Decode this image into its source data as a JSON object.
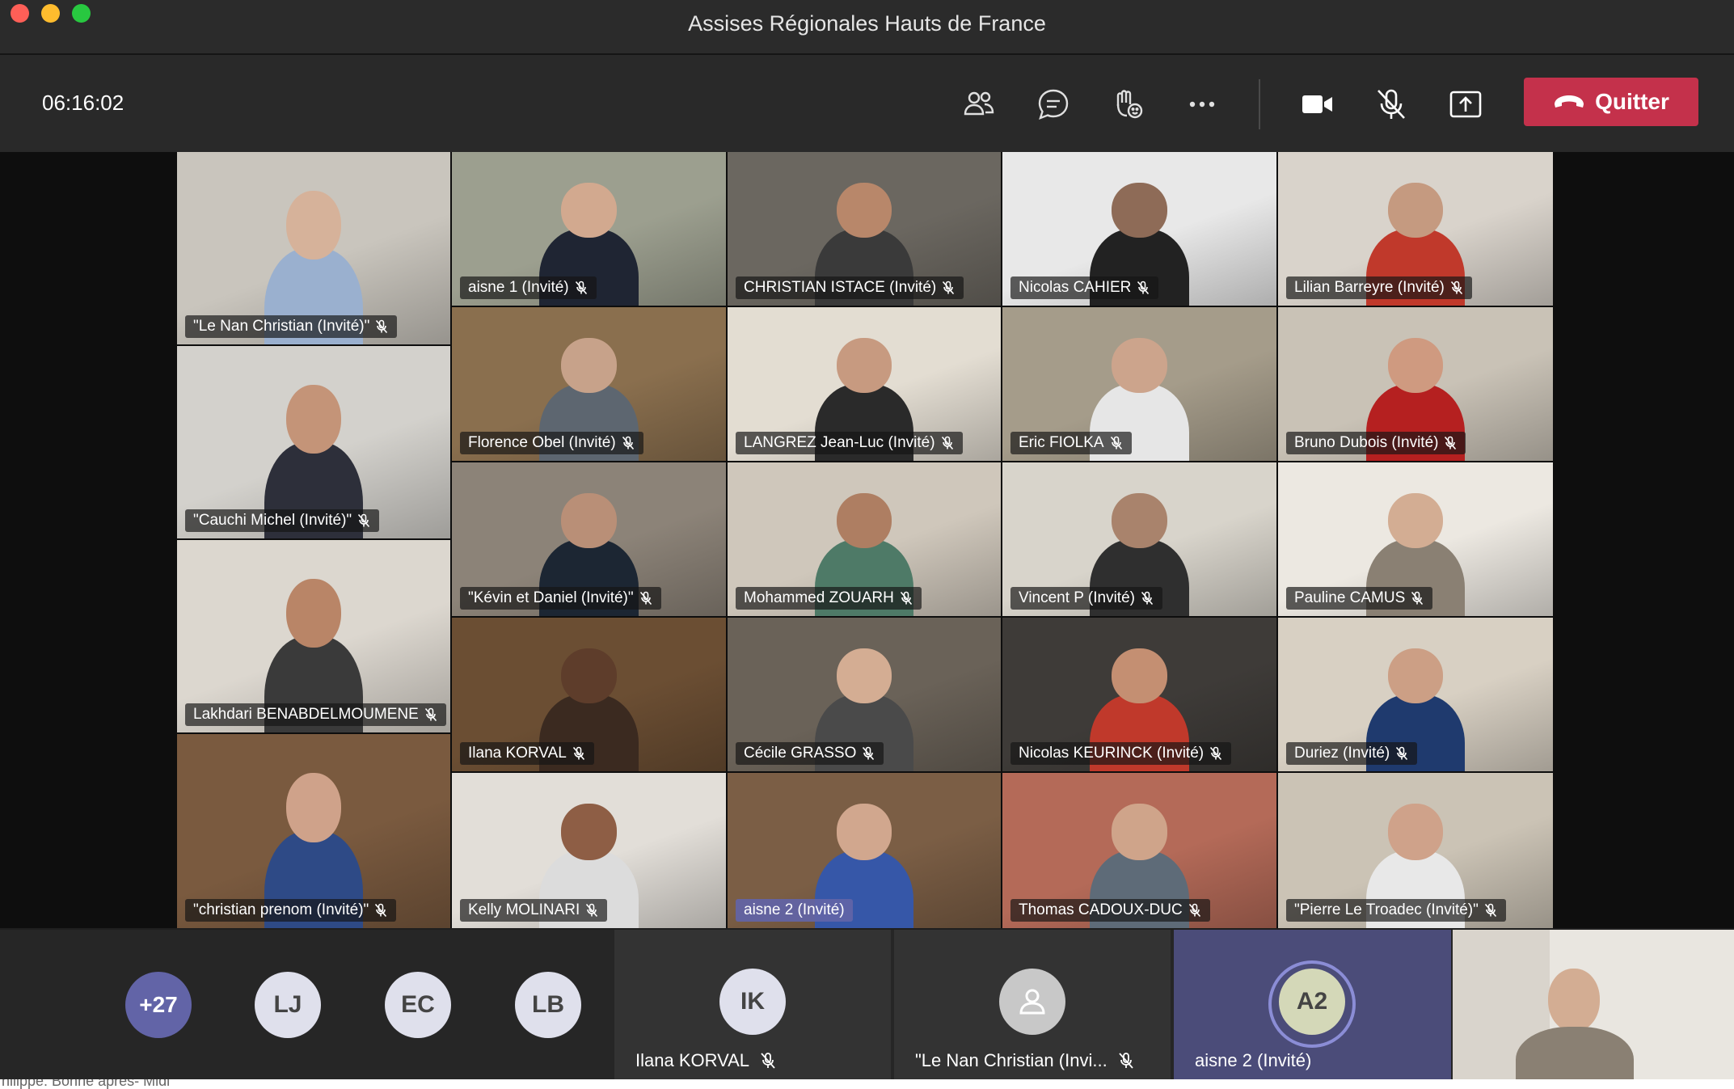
{
  "window": {
    "title": "Assises Régionales Hauts de France"
  },
  "toolbar": {
    "timer": "06:16:02",
    "leave_label": "Quitter",
    "icons": [
      "participants-icon",
      "chat-icon",
      "reactions-icon",
      "more-icon",
      "camera-icon",
      "mic-off-icon",
      "share-icon"
    ]
  },
  "participants": [
    {
      "name": "\"Le Nan Christian (Invité)\"",
      "room": "#c9c5bd",
      "skin": "#d6b29a",
      "shirt": "#9ab0cf"
    },
    {
      "name": "aisne 1 (Invité)",
      "room": "#9c9f8f",
      "skin": "#d2a98f",
      "shirt": "#1f2533"
    },
    {
      "name": "CHRISTIAN ISTACE (Invité)",
      "room": "#6b6760",
      "skin": "#b8876a",
      "shirt": "#3a3a3a"
    },
    {
      "name": "Nicolas CAHIER",
      "room": "#e8e8e8",
      "skin": "#8e6b57",
      "shirt": "#222222"
    },
    {
      "name": "Lilian Barreyre (Invité)",
      "room": "#d9d3cb",
      "skin": "#c59a80",
      "shirt": "#c0392b"
    },
    {
      "name": "\"Cauchi Michel (Invité)\"",
      "room": "#d3d1cc",
      "skin": "#c49478",
      "shirt": "#2d2f3a"
    },
    {
      "name": "Florence Obel (Invité)",
      "room": "#8a6f4e",
      "skin": "#c7a28a",
      "shirt": "#5d6670"
    },
    {
      "name": "LANGREZ Jean-Luc (Invité)",
      "room": "#e3ddd2",
      "skin": "#c79a80",
      "shirt": "#2a2a2a"
    },
    {
      "name": "Eric FIOLKA",
      "room": "#a59c8a",
      "skin": "#cca48c",
      "shirt": "#e6e6e6"
    },
    {
      "name": "Bruno Dubois (Invité)",
      "room": "#c9c2b6",
      "skin": "#cf9a80",
      "shirt": "#b52020"
    },
    {
      "name": "\"Kévin et Daniel (Invité)\"",
      "room": "#8c8378",
      "skin": "#b98f77",
      "shirt": "#1c2633"
    },
    {
      "name": "Mohammed ZOUARH",
      "room": "#cfc7bb",
      "skin": "#ae7e62",
      "shirt": "#4e7a67"
    },
    {
      "name": "Vincent P (Invité)",
      "room": "#d8d4cb",
      "skin": "#a9836c",
      "shirt": "#2f2f2f"
    },
    {
      "name": "Pauline CAMUS",
      "room": "#ece8e1",
      "skin": "#d3ad93",
      "shirt": "#8a8073"
    },
    {
      "name": "Lakhdari BENABDELMOUMENE",
      "room": "#dcd7cf",
      "skin": "#b98567",
      "shirt": "#3a3a3a"
    },
    {
      "name": "Ilana KORVAL",
      "room": "#6b4e33",
      "skin": "#5e3d2b",
      "shirt": "#3b2a20"
    },
    {
      "name": "Cécile GRASSO",
      "room": "#6a6258",
      "skin": "#d4ad93",
      "shirt": "#4a4a4a"
    },
    {
      "name": "Nicolas KEURINCK (Invité)",
      "room": "#3e3b38",
      "skin": "#c48f72",
      "shirt": "#c0392b"
    },
    {
      "name": "Duriez (Invité)",
      "room": "#d8d0c3",
      "skin": "#cc9f85",
      "shirt": "#1f3a6e"
    },
    {
      "name": "\"christian prenom (Invité)\"",
      "room": "#7a5a3f",
      "skin": "#cfa28a",
      "shirt": "#2e4a86"
    },
    {
      "name": "Kelly MOLINARI",
      "room": "#e2ded8",
      "skin": "#8e5e45",
      "shirt": "#dcdcdc"
    },
    {
      "name": "aisne 2 (Invité)",
      "room": "#7b5e45",
      "skin": "#d1a78e",
      "shirt": "#3657a8"
    },
    {
      "name": "Thomas CADOUX-DUC",
      "room": "#b46a58",
      "skin": "#cfa48a",
      "shirt": "#5e6b78"
    },
    {
      "name": "\"Pierre Le Troadec (Invité)\"",
      "room": "#cbc3b5",
      "skin": "#cfa28a",
      "shirt": "#e8e8e8"
    }
  ],
  "strip": {
    "overflow_label": "+27",
    "avatars": [
      "LJ",
      "EC",
      "LB"
    ],
    "tiles": [
      {
        "initials": "IK",
        "name": "Ilana KORVAL"
      },
      {
        "initials": "",
        "name": "\"Le Nan Christian (Invi..."
      },
      {
        "initials": "A2",
        "name": "aisne 2 (Invité)"
      }
    ]
  },
  "chat_peek": "hilippe: Bonne aprés- Midi",
  "colors": {
    "accent": "#6264a7",
    "leave": "#c4314b",
    "background": "#1f1f1f"
  }
}
